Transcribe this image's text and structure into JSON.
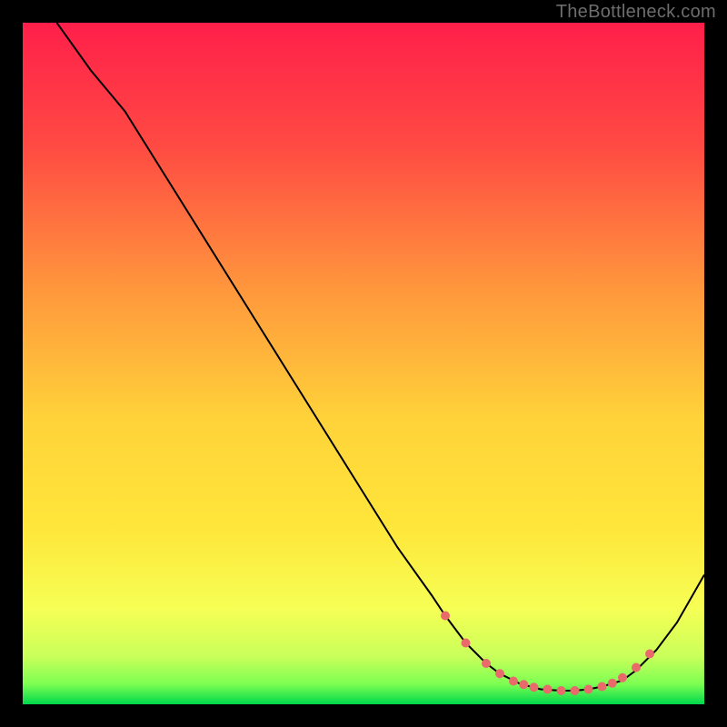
{
  "watermark": "TheBottleneck.com",
  "chart_data": {
    "type": "line",
    "title": "",
    "xlabel": "",
    "ylabel": "",
    "xlim": [
      0,
      100
    ],
    "ylim": [
      0,
      100
    ],
    "background_gradient": {
      "top_color": "#ff1f4a",
      "mid_color": "#ffe63a",
      "bottom_color": "#00d84c"
    },
    "series": [
      {
        "name": "curve",
        "color": "#000000",
        "stroke_width": 2,
        "x": [
          5,
          10,
          15,
          20,
          25,
          30,
          35,
          40,
          45,
          50,
          55,
          60,
          62,
          65,
          68,
          70,
          73,
          76,
          79,
          81,
          83,
          85,
          88,
          90,
          93,
          96,
          100
        ],
        "y": [
          100,
          93,
          87,
          79,
          71,
          63,
          55,
          47,
          39,
          31,
          23,
          16,
          13,
          9,
          6,
          4.5,
          3,
          2.2,
          2,
          2,
          2.2,
          2.6,
          3.5,
          5,
          8,
          12,
          19
        ]
      }
    ],
    "markers": {
      "color": "#e86a6a",
      "radius": 5,
      "points": [
        {
          "x": 62,
          "y": 13
        },
        {
          "x": 65,
          "y": 9
        },
        {
          "x": 68,
          "y": 6
        },
        {
          "x": 70,
          "y": 4.5
        },
        {
          "x": 72,
          "y": 3.4
        },
        {
          "x": 73.5,
          "y": 2.9
        },
        {
          "x": 75,
          "y": 2.5
        },
        {
          "x": 77,
          "y": 2.2
        },
        {
          "x": 79,
          "y": 2.0
        },
        {
          "x": 81,
          "y": 2.0
        },
        {
          "x": 83,
          "y": 2.2
        },
        {
          "x": 85,
          "y": 2.6
        },
        {
          "x": 86.5,
          "y": 3.1
        },
        {
          "x": 88,
          "y": 3.9
        },
        {
          "x": 90,
          "y": 5.4
        },
        {
          "x": 92,
          "y": 7.4
        }
      ]
    }
  }
}
